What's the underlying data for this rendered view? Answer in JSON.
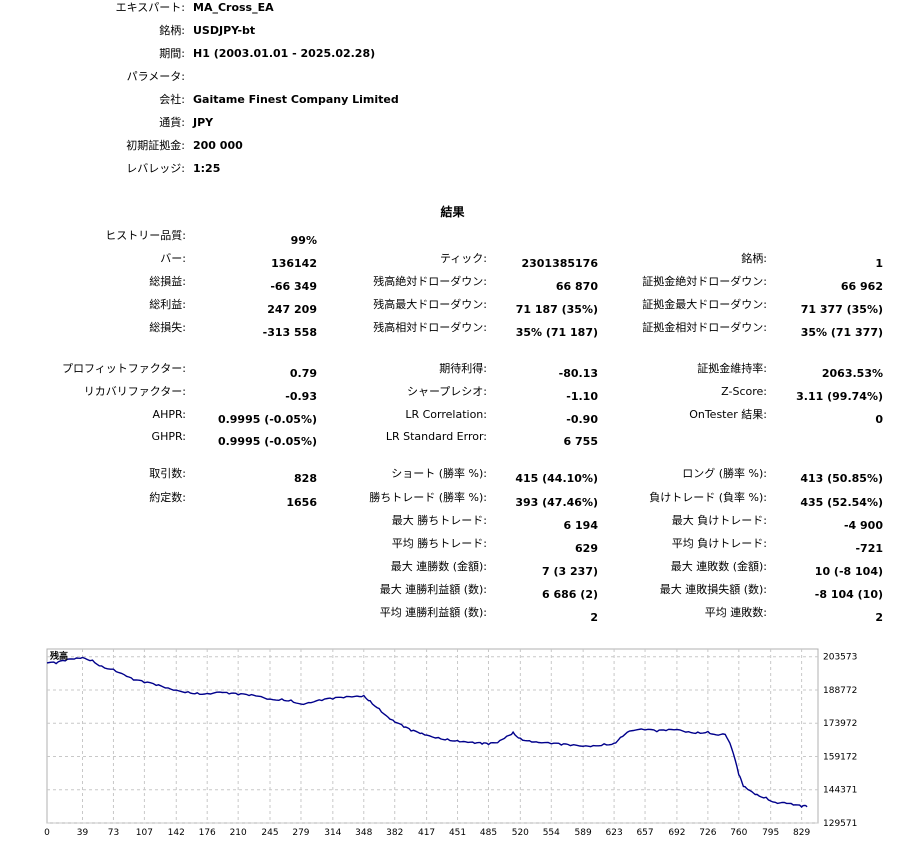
{
  "settings": [
    {
      "label": "エキスパート:",
      "value": "MA_Cross_EA"
    },
    {
      "label": "銘柄:",
      "value": "USDJPY-bt"
    },
    {
      "label": "期間:",
      "value": "H1 (2003.01.01 - 2025.02.28)"
    },
    {
      "label": "パラメータ:",
      "value": ""
    },
    {
      "label": "会社:",
      "value": "Gaitame Finest Company Limited"
    },
    {
      "label": "通貨:",
      "value": "JPY"
    },
    {
      "label": "初期証拠金:",
      "value": "200 000"
    },
    {
      "label": "レバレッジ:",
      "value": "1:25"
    }
  ],
  "results_title": "結果",
  "col1": [
    {
      "label": "ヒストリー品質:",
      "value": "99%"
    },
    {
      "label": "バー:",
      "value": "136142"
    },
    {
      "label": "総損益:",
      "value": "-66 349"
    },
    {
      "label": "総利益:",
      "value": "247 209"
    },
    {
      "label": "総損失:",
      "value": "-313 558"
    },
    {
      "label": "プロフィットファクター:",
      "value": "0.79"
    },
    {
      "label": "リカバリファクター:",
      "value": "-0.93"
    },
    {
      "label": "AHPR:",
      "value": "0.9995 (-0.05%)"
    },
    {
      "label": "GHPR:",
      "value": "0.9995 (-0.05%)"
    },
    {
      "label": "取引数:",
      "value": "828"
    },
    {
      "label": "約定数:",
      "value": "1656"
    }
  ],
  "col2": [
    {
      "label": "ティック:",
      "value": "2301385176"
    },
    {
      "label": "残高絶対ドローダウン:",
      "value": "66 870"
    },
    {
      "label": "残高最大ドローダウン:",
      "value": "71 187 (35%)"
    },
    {
      "label": "残高相対ドローダウン:",
      "value": "35% (71 187)"
    },
    {
      "label": "期待利得:",
      "value": "-80.13"
    },
    {
      "label": "シャープレシオ:",
      "value": "-1.10"
    },
    {
      "label": "LR Correlation:",
      "value": "-0.90"
    },
    {
      "label": "LR Standard Error:",
      "value": "6 755"
    },
    {
      "label": "ショート (勝率 %):",
      "value": "415 (44.10%)"
    },
    {
      "label": "勝ちトレード (勝率 %):",
      "value": "393 (47.46%)"
    },
    {
      "label": "最大 勝ちトレード:",
      "value": "6 194"
    },
    {
      "label": "平均 勝ちトレード:",
      "value": "629"
    },
    {
      "label": "最大 連勝数 (金額):",
      "value": "7 (3 237)"
    },
    {
      "label": "最大 連勝利益額 (数):",
      "value": "6 686 (2)"
    },
    {
      "label": "平均 連勝利益額 (数):",
      "value": "2"
    }
  ],
  "col3": [
    {
      "label": "銘柄:",
      "value": "1"
    },
    {
      "label": "証拠金絶対ドローダウン:",
      "value": "66 962"
    },
    {
      "label": "証拠金最大ドローダウン:",
      "value": "71 377 (35%)"
    },
    {
      "label": "証拠金相対ドローダウン:",
      "value": "35% (71 377)"
    },
    {
      "label": "証拠金維持率:",
      "value": "2063.53%"
    },
    {
      "label": "Z-Score:",
      "value": "3.11 (99.74%)"
    },
    {
      "label": "OnTester 結果:",
      "value": "0"
    },
    {
      "label": "ロング (勝率 %):",
      "value": "413 (50.85%)"
    },
    {
      "label": "負けトレード (負率 %):",
      "value": "435 (52.54%)"
    },
    {
      "label": "最大 負けトレード:",
      "value": "-4 900"
    },
    {
      "label": "平均 負けトレード:",
      "value": "-721"
    },
    {
      "label": "最大 連敗数 (金額):",
      "value": "10 (-8 104)"
    },
    {
      "label": "最大 連敗損失額 (数):",
      "value": "-8 104 (10)"
    },
    {
      "label": "平均 連敗数:",
      "value": "2"
    }
  ],
  "chart_data": {
    "type": "line",
    "title": "残高",
    "series": [
      {
        "name": "残高",
        "color": "#00008b",
        "x": [
          0,
          10,
          20,
          30,
          39,
          50,
          60,
          73,
          85,
          95,
          107,
          120,
          130,
          142,
          155,
          165,
          176,
          190,
          200,
          210,
          222,
          232,
          245,
          258,
          268,
          279,
          290,
          302,
          314,
          326,
          338,
          348,
          355,
          365,
          375,
          382,
          392,
          400,
          410,
          417,
          430,
          440,
          451,
          460,
          470,
          478,
          485,
          495,
          505,
          512,
          520,
          530,
          540,
          554,
          565,
          575,
          589,
          600,
          612,
          623,
          630,
          640,
          657,
          670,
          680,
          692,
          705,
          715,
          726,
          735,
          745,
          752,
          760,
          765,
          772,
          780,
          790,
          800,
          810,
          820,
          829,
          835
        ],
        "y": [
          200800,
          200500,
          201700,
          202500,
          203200,
          202000,
          199500,
          198000,
          195500,
          193200,
          192000,
          190800,
          189700,
          188700,
          188000,
          187500,
          187200,
          187800,
          187000,
          186600,
          186300,
          186000,
          184700,
          184800,
          184300,
          182500,
          183100,
          184100,
          184700,
          185300,
          185900,
          186300,
          184000,
          180500,
          176500,
          174500,
          172200,
          170500,
          169400,
          168700,
          167600,
          167000,
          166300,
          165700,
          165000,
          164700,
          164500,
          165300,
          168200,
          170000,
          167300,
          166200,
          165400,
          164800,
          164300,
          164000,
          163700,
          164000,
          164800,
          165100,
          167700,
          170500,
          171000,
          170200,
          170700,
          171200,
          170200,
          170000,
          170300,
          168800,
          169000,
          163000,
          151000,
          145800,
          144100,
          142300,
          141000,
          138800,
          138700,
          137600,
          136700,
          136800
        ]
      }
    ],
    "xlim": [
      0,
      847
    ],
    "ylim": [
      129571,
      207000
    ],
    "xticks": [
      0,
      39,
      73,
      107,
      142,
      176,
      210,
      245,
      279,
      314,
      348,
      382,
      417,
      451,
      485,
      520,
      554,
      589,
      623,
      657,
      692,
      726,
      760,
      795,
      829
    ],
    "yticks": [
      203573,
      188772,
      173972,
      159172,
      144371,
      129571
    ],
    "grid": true
  }
}
